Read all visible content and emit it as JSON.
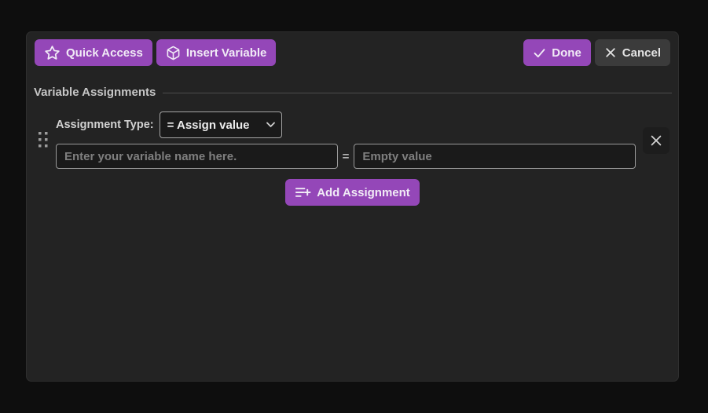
{
  "dialog": {
    "toolbar": {
      "quick_access_label": "Quick Access",
      "insert_variable_label": "Insert Variable",
      "done_label": "Done",
      "cancel_label": "Cancel"
    },
    "section_title": "Variable Assignments",
    "assignment_row": {
      "type_label": "Assignment Type:",
      "type_selected": "= Assign value",
      "variable_name_placeholder": "Enter your variable name here.",
      "equals_sign": "=",
      "value_placeholder": "Empty value"
    },
    "add_assignment_label": "Add Assignment"
  },
  "icons": {
    "quick_access": "star-icon",
    "insert_variable": "cube-icon",
    "done": "check-icon",
    "cancel": "x-icon",
    "row_drag": "drag-handle-icon",
    "row_remove": "close-icon",
    "type_select": "chevron-down-icon",
    "add_assignment": "playlist-add-icon"
  },
  "colors": {
    "page_background": "#0e0e0e",
    "dialog_background": "#232323",
    "accent_purple": "#9447b8",
    "cancel_gray": "#3b3b3b",
    "input_background": "#1a1a1a",
    "input_border": "#9a9a9a",
    "placeholder_text": "#7f7f7f",
    "divider": "#4c4c4c"
  }
}
